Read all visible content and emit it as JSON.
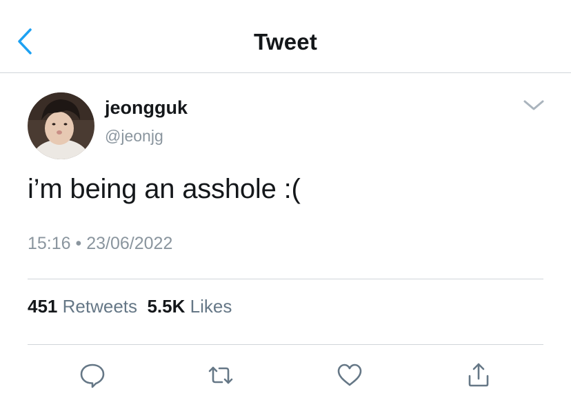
{
  "header": {
    "title": "Tweet"
  },
  "tweet": {
    "display_name": "jeongguk",
    "handle": "@jeonjg",
    "text": "i’m being an asshole :(",
    "time": "15:16",
    "separator": "•",
    "date": "23/06/2022"
  },
  "stats": {
    "retweets_count": "451",
    "retweets_label": "Retweets",
    "likes_count": "5.5K",
    "likes_label": "Likes"
  },
  "colors": {
    "accent": "#1da1f2",
    "secondary_text": "#8a959e",
    "divider": "#d0d5d9",
    "icon": "#657786"
  },
  "icons": {
    "back": "chevron-left-icon",
    "more": "chevron-down-icon",
    "reply": "speech-bubble-icon",
    "retweet": "retweet-icon",
    "like": "heart-icon",
    "share": "share-icon"
  }
}
